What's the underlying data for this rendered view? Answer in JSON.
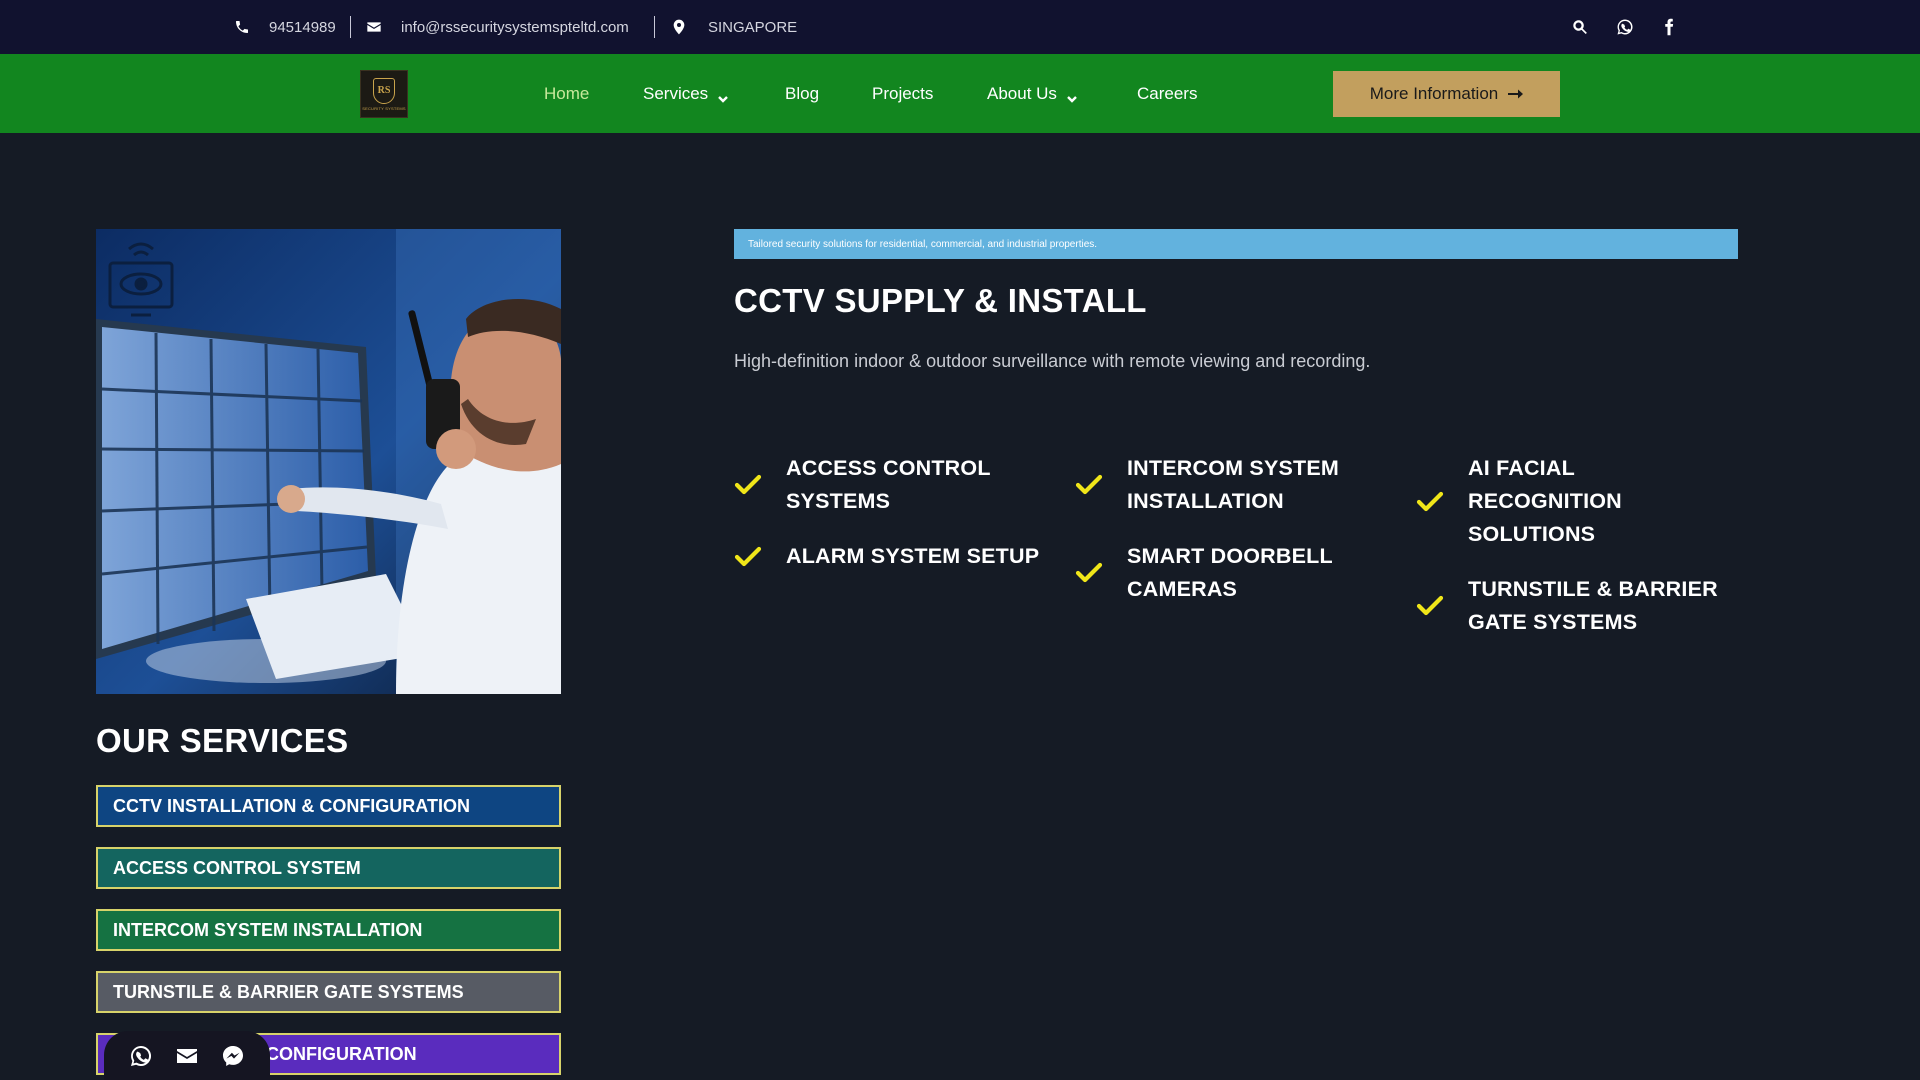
{
  "topbar": {
    "phone": "94514989",
    "email": "info@rssecuritysystemspteltd.com",
    "location": "SINGAPORE",
    "icons": [
      "phone-icon",
      "envelope-icon",
      "map-pin-icon",
      "search-icon",
      "whatsapp-icon",
      "facebook-icon"
    ]
  },
  "nav": {
    "logo_text": "RS",
    "logo_subtext": "SECURITY SYSTEMS",
    "items": [
      {
        "label": "Home",
        "active": true
      },
      {
        "label": "Services",
        "dropdown": true
      },
      {
        "label": "Blog"
      },
      {
        "label": "Projects"
      },
      {
        "label": "About Us",
        "dropdown": true
      },
      {
        "label": "Careers"
      }
    ],
    "cta_label": "More Information"
  },
  "sidebar": {
    "title": "OUR SERVICES",
    "services": [
      {
        "label": "CCTV INSTALLATION & CONFIGURATION",
        "color": "#0e4582"
      },
      {
        "label": "ACCESS CONTROL SYSTEM",
        "color": "#14655f"
      },
      {
        "label": "INTERCOM SYSTEM INSTALLATION",
        "color": "#157242"
      },
      {
        "label": "TURNSTILE & BARRIER GATE SYSTEMS",
        "color": "#575b64"
      },
      {
        "label": "CONFIGURATION",
        "color": "#5a2cbe"
      }
    ]
  },
  "float_widget": {
    "icons": [
      "whatsapp-icon",
      "envelope-icon",
      "messenger-icon"
    ]
  },
  "main": {
    "tagline": "Tailored security solutions for residential, commercial, and industrial properties.",
    "title": "CCTV SUPPLY & INSTALL",
    "description": "High-definition indoor & outdoor surveillance with remote viewing and recording.",
    "features": [
      [
        "ACCESS CONTROL",
        "SYSTEMS"
      ],
      [
        "ALARM SYSTEM SETUP"
      ],
      [
        "INTERCOM SYSTEM",
        "INSTALLATION"
      ],
      [
        "SMART DOORBELL",
        "CAMERAS"
      ],
      [
        "AI FACIAL",
        "RECOGNITION",
        "SOLUTIONS"
      ],
      [
        "TURNSTILE & BARRIER",
        "GATE SYSTEMS"
      ]
    ]
  },
  "colors": {
    "topbar_bg": "#11122f",
    "nav_bg": "#12861f",
    "nav_active": "#c7e89b",
    "cta_bg": "#c29f5e",
    "page_bg": "#151b25",
    "tagline_bg": "#62b2de",
    "check": "#f0e619",
    "service_border": "#d7d36a"
  }
}
